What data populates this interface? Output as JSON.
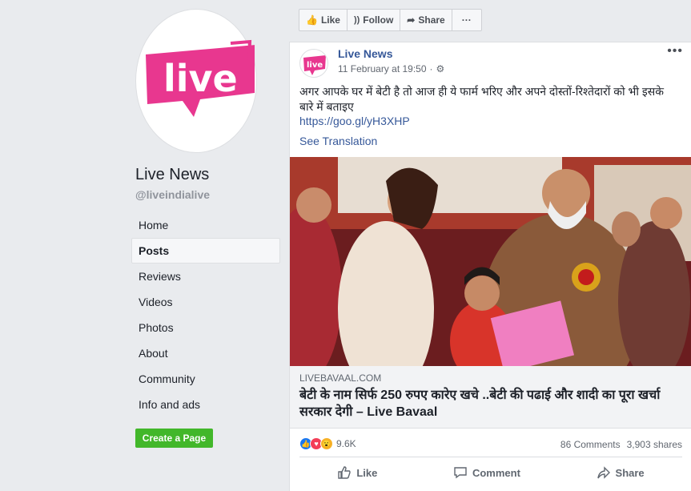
{
  "sidebar": {
    "logo_text": "live",
    "page_name": "Live News",
    "handle": "@liveindialive",
    "nav": [
      {
        "label": "Home",
        "active": false
      },
      {
        "label": "Posts",
        "active": true
      },
      {
        "label": "Reviews",
        "active": false
      },
      {
        "label": "Videos",
        "active": false
      },
      {
        "label": "Photos",
        "active": false
      },
      {
        "label": "About",
        "active": false
      },
      {
        "label": "Community",
        "active": false
      },
      {
        "label": "Info and ads",
        "active": false
      }
    ],
    "create_page": "Create a Page"
  },
  "action_bar": {
    "like": "Like",
    "follow": "Follow",
    "share": "Share",
    "more": "···"
  },
  "post": {
    "author": "Live News",
    "timestamp": "11 February at 19:50",
    "more": "•••",
    "text": "अगर आपके घर में बेटी है तो आज ही ये फार्म भरिए और अपने दोस्तों-रिश्तेदारों को भी इसके बारे में बताइए",
    "link": "https://goo.gl/yH3XHP",
    "see_translation": "See Translation",
    "link_domain": "LIVEBAVAAL.COM",
    "link_title": "बेटी के नाम सिर्फ 250 रुपए कारेए खचे ..बेटी की पढाई और शादी का पूरा खर्चा सरकार देगी – Live Bavaal",
    "reaction_count": "9.6K",
    "comments": "86 Comments",
    "shares": "3,903 shares",
    "actions": {
      "like": "Like",
      "comment": "Comment",
      "share": "Share"
    }
  },
  "colors": {
    "brand_pink": "#e8378f",
    "link_blue": "#365899",
    "create_green": "#42b72a"
  }
}
